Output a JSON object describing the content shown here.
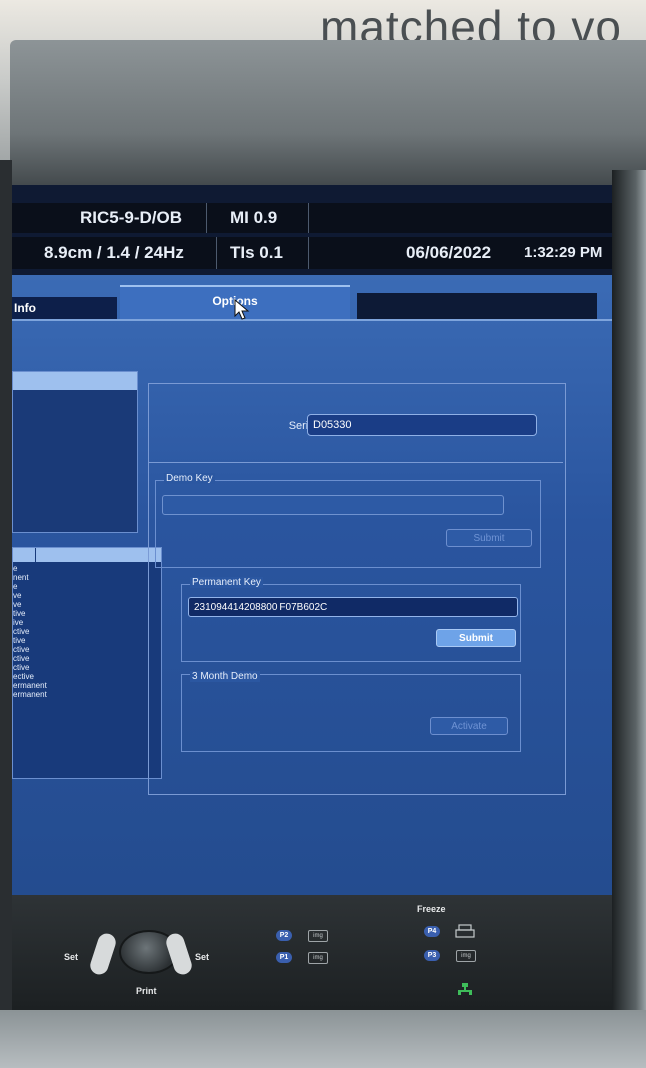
{
  "wall": {
    "text": "matched to vo"
  },
  "header": {
    "probe": "RIC5-9-D/OB",
    "mi": "MI 0.9",
    "depth_freq": "8.9cm / 1.4 / 24Hz",
    "tis": "TIs 0.1",
    "date": "06/06/2022",
    "time": "1:32:29 PM"
  },
  "tabs": [
    {
      "label": "Info"
    },
    {
      "label": "Options",
      "active": true
    }
  ],
  "options_list": {
    "items": [
      "e",
      "nent",
      "e",
      "ve",
      "ve",
      "tive",
      "ive",
      "ctive",
      "tive",
      "ctive",
      "ctive",
      "ctive",
      "ective",
      "ermanent",
      "ermanent"
    ]
  },
  "serial": {
    "label": "Serial Number",
    "value": "D05330"
  },
  "demo_key": {
    "title": "Demo Key",
    "value": "",
    "submit_label": "Submit"
  },
  "permanent_key": {
    "title": "Permanent Key",
    "value": "231094414208800 F07B602C",
    "submit_label": "Submit"
  },
  "three_month_demo": {
    "title": "3 Month Demo",
    "activate_label": "Activate"
  },
  "console": {
    "set_left": "Set",
    "set_right": "Set",
    "print": "Print",
    "freeze": "Freeze",
    "p1": "P1",
    "p2": "P2",
    "p3": "P3",
    "p4": "P4",
    "img": "img"
  }
}
